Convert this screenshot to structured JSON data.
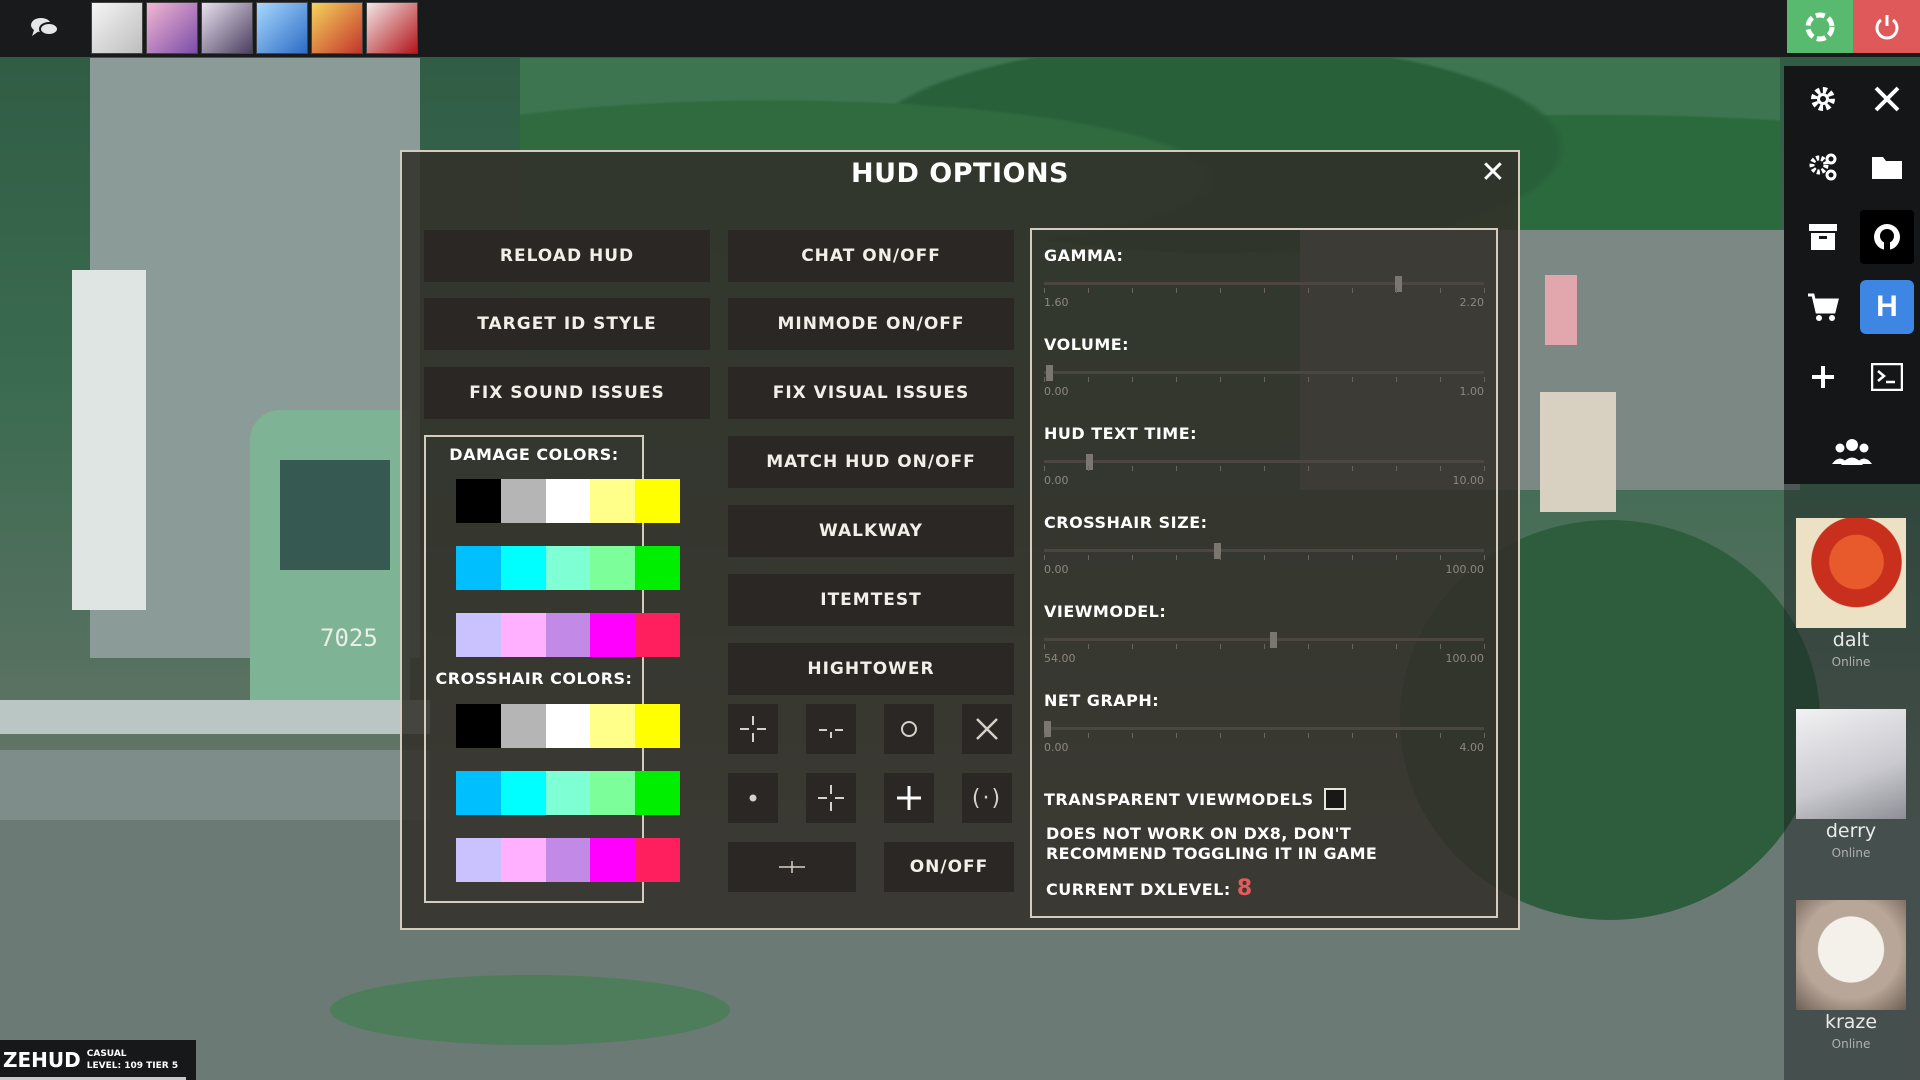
{
  "topbar": {
    "avatars": [
      "avatar-1",
      "avatar-2",
      "avatar-3",
      "avatar-4",
      "avatar-5",
      "avatar-6"
    ],
    "colors": {
      "green": "#57ba6e",
      "red": "#e0595a"
    }
  },
  "background": {
    "tram_number": "7025"
  },
  "dialog": {
    "title": "HUD OPTIONS",
    "buttons_col1": [
      "RELOAD HUD",
      "TARGET ID STYLE",
      "FIX SOUND ISSUES"
    ],
    "buttons_col2": [
      "CHAT ON/OFF",
      "MINMODE ON/OFF",
      "FIX VISUAL ISSUES",
      "MATCH HUD ON/OFF",
      "WALKWAY",
      "ITEMTEST",
      "HIGHTOWER"
    ],
    "crosshair_toggle": "ON/OFF",
    "damage_colors_title": "DAMAGE COLORS:",
    "crosshair_colors_title": "CROSSHAIR COLORS:",
    "color_rows": [
      [
        "#000000",
        "#b5b5b5",
        "#ffffff",
        "#ffff8a",
        "#ffff00"
      ],
      [
        "#00bfff",
        "#00ffff",
        "#7fffd4",
        "#7cff9a",
        "#00ee00"
      ],
      [
        "#c9c2ff",
        "#ffb0ff",
        "#c28ae6",
        "#ff00ff",
        "#ff1f5e"
      ]
    ],
    "settings": {
      "sliders": [
        {
          "label": "GAMMA:",
          "min": "1.60",
          "max": "2.20",
          "value": 2.1
        },
        {
          "label": "VOLUME:",
          "min": "0.00",
          "max": "1.00",
          "value": 0.0
        },
        {
          "label": "HUD TEXT TIME:",
          "min": "0.00",
          "max": "10.00",
          "value": 1.0
        },
        {
          "label": "CROSSHAIR SIZE:",
          "min": "0.00",
          "max": "100.00",
          "value": 40
        },
        {
          "label": "VIEWMODEL:",
          "min": "54.00",
          "max": "100.00",
          "value": 75
        },
        {
          "label": "NET GRAPH:",
          "min": "0.00",
          "max": "4.00",
          "value": 0.0
        }
      ],
      "transparent_viewmodels": "TRANSPARENT VIEWMODELS",
      "warning": "DOES NOT WORK ON DX8, DON'T RECOMMEND TOGGLING IT IN GAME",
      "dxlevel_label": "CURRENT DXLEVEL:",
      "dxlevel_value": "8"
    }
  },
  "friends": [
    {
      "name": "dalt",
      "status": "Online"
    },
    {
      "name": "derry",
      "status": "Online"
    },
    {
      "name": "kraze",
      "status": "Online"
    }
  ],
  "badge": {
    "logo": "ZEHUD",
    "line1": "CASUAL",
    "line2": "LEVEL: 109 TIER 5"
  }
}
